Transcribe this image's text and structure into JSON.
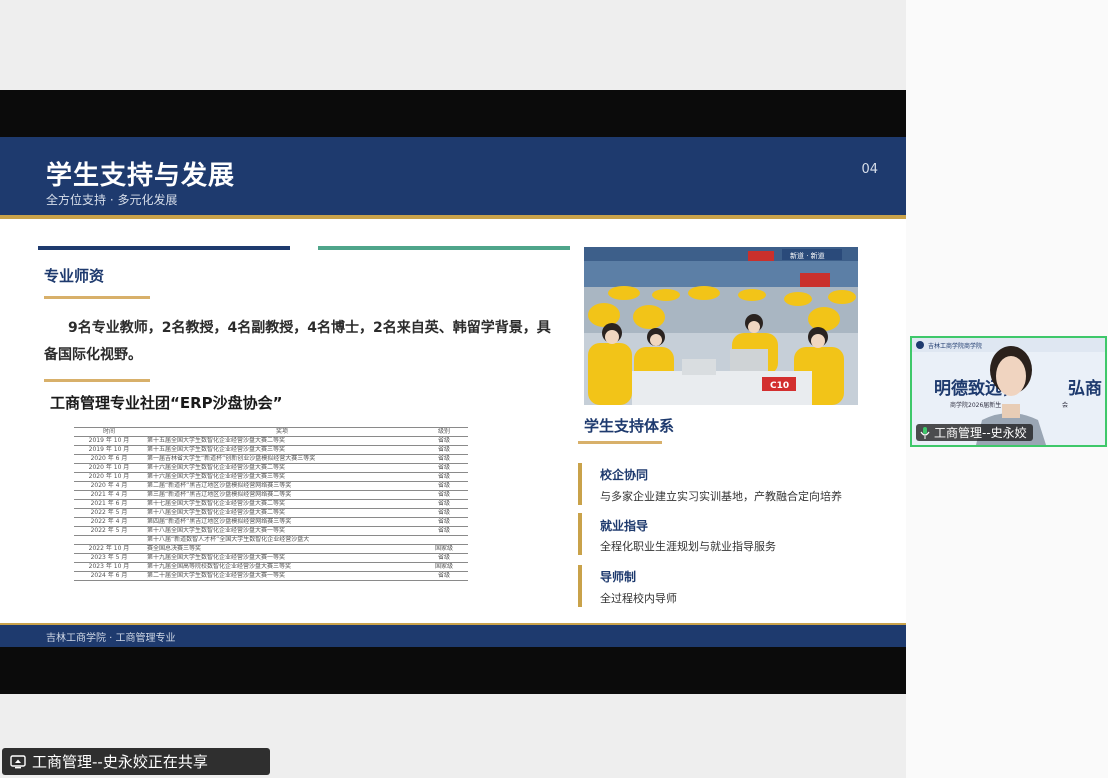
{
  "slide": {
    "title": "学生支持与发展",
    "subtitle": "全方位支持 · 多元化发展",
    "page_number": "04",
    "faculty": {
      "heading": "专业师资",
      "text": "9名专业教师，2名教授，4名副教授，4名博士，2名来自英、韩留学背景，具备国际化视野。"
    },
    "club": {
      "title": "工商管理专业社团“ERP沙盘协会”"
    },
    "awards_table": {
      "headers": [
        "时间",
        "奖项",
        "级别"
      ],
      "rows": [
        [
          "2019 年 10 月",
          "第十五届全国大学生数智化企业经营沙盘大赛二等奖",
          "省级"
        ],
        [
          "2019 年 10 月",
          "第十五届全国大学生数智化企业经营沙盘大赛三等奖",
          "省级"
        ],
        [
          "2020 年 6 月",
          "第一届吉林省大学生“新道杯”创新创业沙盘模拟经营大赛三等奖",
          "省级"
        ],
        [
          "2020 年 10 月",
          "第十六届全国大学生数智化企业经营沙盘大赛二等奖",
          "省级"
        ],
        [
          "2020 年 10 月",
          "第十六届全国大学生数智化企业经营沙盘大赛三等奖",
          "省级"
        ],
        [
          "2020 年 4 月",
          "第二届“新道杯”黑吉辽地区沙盘模拟经营网络赛三等奖",
          "省级"
        ],
        [
          "2021 年 4 月",
          "第三届“新道杯”黑吉辽地区沙盘模拟经营网络赛二等奖",
          "省级"
        ],
        [
          "2021 年 6 月",
          "第十七届全国大学生数智化企业经营沙盘大赛二等奖",
          "省级"
        ],
        [
          "2022 年 5 月",
          "第十八届全国大学生数智化企业经营沙盘大赛二等奖",
          "省级"
        ],
        [
          "2022 年 4 月",
          "第四届“新道杯”黑吉辽地区沙盘模拟经营网络赛三等奖",
          "省级"
        ],
        [
          "2022 年 5 月",
          "第十八届全国大学生数智化企业经营沙盘大赛一等奖",
          "省级"
        ],
        [
          "",
          "第十八届“新道数智人才杯”全国大学生数智化企业经营沙盘大",
          ""
        ],
        [
          "2022 年 10 月",
          "赛全国总决赛三等奖",
          "国家级"
        ],
        [
          "2023 年 5 月",
          "第十九届全国大学生数智化企业经营沙盘大赛一等奖",
          "省级"
        ],
        [
          "2023 年 10 月",
          "第十九届全国高等院校数智化企业经营沙盘大赛三等奖",
          "国家级"
        ],
        [
          "2024 年 6 月",
          "第二十届全国大学生数智化企业经营沙盘大赛一等奖",
          "省级"
        ]
      ]
    },
    "photo": {
      "banner_text": "新道 · 新道",
      "table_sign": "C10"
    },
    "support": {
      "heading": "学生支持体系",
      "items": [
        {
          "title": "校企协同",
          "desc": "与多家企业建立实习实训基地，产教融合定向培养"
        },
        {
          "title": "就业指导",
          "desc": "全程化职业生涯规划与就业指导服务"
        },
        {
          "title": "导师制",
          "desc": "全过程校内导师"
        }
      ]
    },
    "footer": "吉林工商学院 · 工商管理专业"
  },
  "webcam": {
    "banner_big": "明德致远，",
    "banner_big_2": "弘商",
    "banner_small": "商学院2026届新生",
    "banner_small_2": "会",
    "header_small": "吉林工商学院商学院",
    "label": "工商管理--史永姣"
  },
  "share_bar": {
    "text": "工商管理--史永姣正在共享"
  },
  "colors": {
    "navy": "#1e3a6e",
    "gold": "#c9a24a",
    "teal": "#4fa58a",
    "webcam_border": "#3ec86a"
  }
}
